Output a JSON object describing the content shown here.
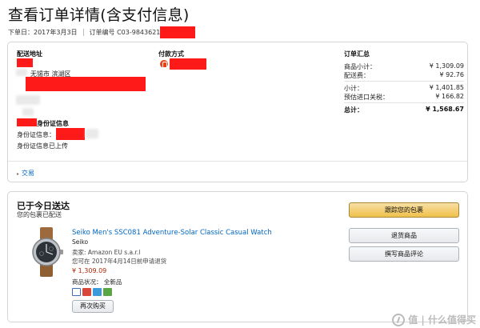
{
  "page_title": "查看订单详情(含支付信息)",
  "order_meta": {
    "date_label": "下单日：2017年3月3日",
    "number_label": "订单编号 C03-9843621"
  },
  "shipping": {
    "heading": "配送地址",
    "line_city": "无锡市 滨湖区"
  },
  "payment": {
    "heading": "付款方式"
  },
  "id_info": {
    "heading": "身份证信息",
    "id_label": "身份证信息：",
    "status": "身份证信息已上传"
  },
  "summary": {
    "heading": "订单汇总",
    "rows": [
      {
        "label": "商品小计：",
        "value": "¥ 1,309.09"
      },
      {
        "label": "配送费：",
        "value": "¥ 92.76"
      },
      {
        "label": "小计：",
        "value": "¥ 1,401.85"
      },
      {
        "label": "预估进口关税：",
        "value": "¥ 166.82"
      },
      {
        "label": "总计：",
        "value": "¥ 1,568.67"
      }
    ]
  },
  "transactions_link": "交易",
  "shipment": {
    "title": "已于今日送达",
    "subtitle": "您的包裹已配送",
    "product": {
      "name": "Seiko Men's SSC081 Adventure-Solar Classic Casual Watch",
      "brand": "Seiko",
      "seller": "卖家: Amazon EU s.a.r.l",
      "return_note": "您可在 2017年4月14日前申请退货",
      "price": "¥ 1,309.09",
      "condition": "商品状况： 全新品",
      "buy_again": "再次购买"
    },
    "buttons": {
      "track": "跟踪您的包裹",
      "return": "退货商品",
      "review": "撰写商品评论"
    }
  },
  "watermark": "值 | 什么值得买",
  "colors": {
    "link": "#0066c0",
    "price": "#b12704",
    "redaction": "#ff1a1a",
    "primary_button": "#f0c14b"
  }
}
